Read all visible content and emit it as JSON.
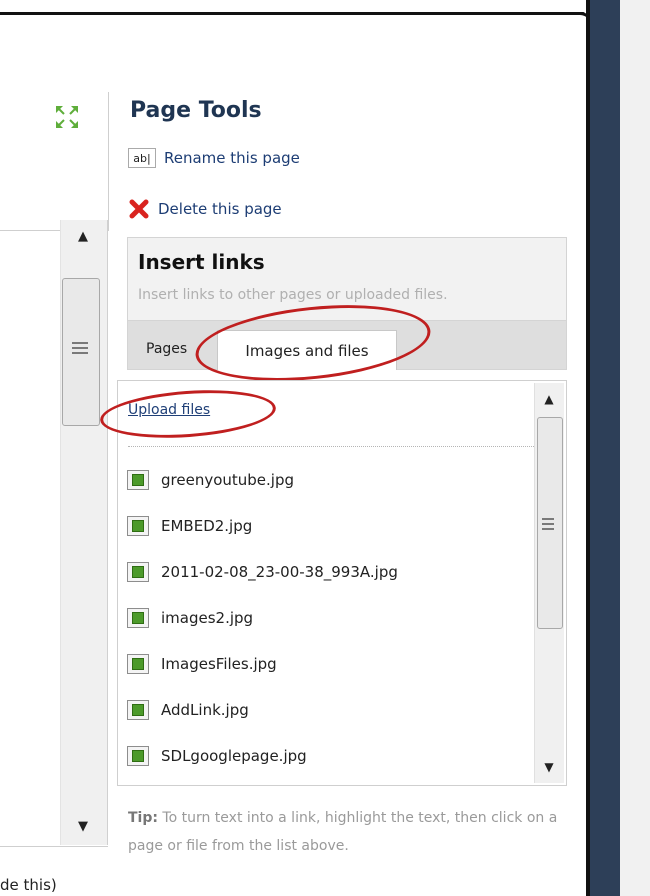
{
  "editor": {
    "bottom_text": "de this)"
  },
  "page_tools": {
    "title": "Page Tools",
    "rename_icon_text": "ab|",
    "rename_label": "Rename this page",
    "delete_label": "Delete this page"
  },
  "insert_links": {
    "title": "Insert links",
    "description": "Insert links to other pages or uploaded files.",
    "tabs": [
      {
        "label": "Pages",
        "active": false
      },
      {
        "label": "Images and files",
        "active": true
      }
    ],
    "upload_label": "Upload files",
    "files": [
      "greenyoutube.jpg",
      "EMBED2.jpg",
      "2011-02-08_23-00-38_993A.jpg",
      "images2.jpg",
      "ImagesFiles.jpg",
      "AddLink.jpg",
      "SDLgooglepage.jpg"
    ]
  },
  "tip": {
    "label": "Tip:",
    "text": " To turn text into a link, highlight the text, then click on a page or file from the list above."
  },
  "icons": {
    "fullscreen": "expand-arrows-icon",
    "rename": "rename-icon",
    "delete": "red-x-delete-icon",
    "file": "image-file-icon",
    "scroll_up": "scroll-up-arrow-icon",
    "scroll_down": "scroll-down-arrow-icon"
  },
  "colors": {
    "annotation_ring": "#c01f1f",
    "link": "#1d3d74",
    "dark_border": "#2d3f58",
    "delete_x": "#d9231f"
  }
}
